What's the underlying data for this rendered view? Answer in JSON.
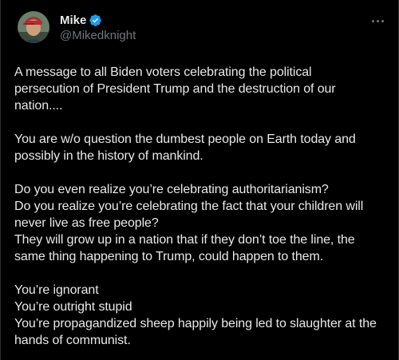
{
  "author": {
    "display_name": "Mike",
    "handle": "@Mikedknight",
    "verified": true,
    "verified_color": "#1d9bf0"
  },
  "menu": {
    "icon": "more-horizontal-icon"
  },
  "tweet": {
    "paragraphs": [
      {
        "lines": [
          "A message to all Biden voters celebrating the political",
          "persecution of President Trump and the destruction of our",
          "nation...."
        ]
      },
      {
        "lines": [
          "You are w/o question the dumbest people on Earth today and",
          "possibly in the history of mankind."
        ]
      },
      {
        "lines": [
          "Do you even realize you’re celebrating authoritarianism?",
          "Do you realize you’re celebrating the fact that your children will",
          "never live as free people?",
          "They will grow up in a nation that if they don’t toe the line, the",
          "same thing happening to Trump, could happen to them."
        ]
      },
      {
        "lines": [
          "You’re ignorant",
          "You’re outright stupid",
          "You’re propagandized sheep happily being led to slaughter at the",
          "hands of communist."
        ]
      }
    ]
  },
  "colors": {
    "background": "#000000",
    "text": "#e7e9ea",
    "secondary_text": "#71767b",
    "border": "#2f3336"
  }
}
